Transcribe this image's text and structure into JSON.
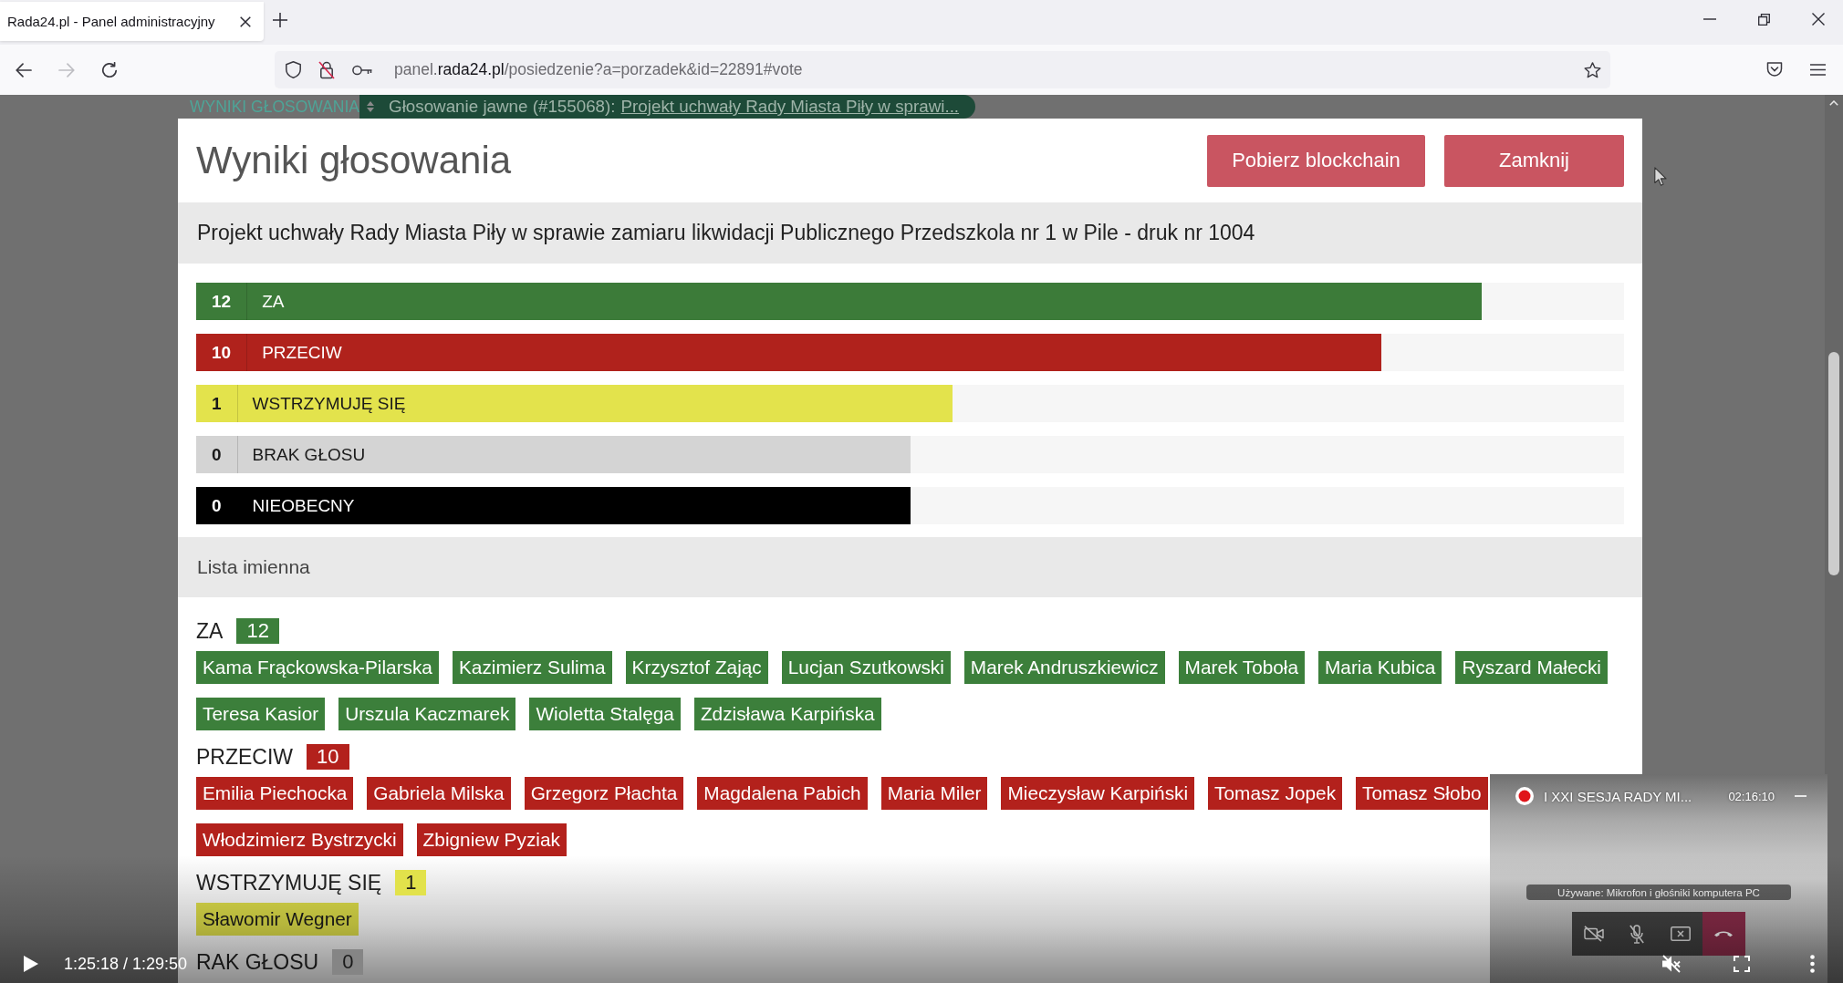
{
  "browser": {
    "tabs": [
      {
        "title": "Rada24.pl - Panel administracyjny",
        "selected": true
      }
    ],
    "nav_buttons": [
      {
        "disabled": false
      },
      {
        "disabled": true
      },
      {
        "disabled": false
      }
    ],
    "url": {
      "prefix": "panel.",
      "domain": "rada24.pl",
      "path": "/posiedzenie?a=porzadek&id=22891#vote"
    }
  },
  "page": {
    "section": "WYNIKI GŁOSOWANIA",
    "vote_label": "Głosowanie jawne (#155068):",
    "vote_link": "Projekt uchwały Rady Miasta Piły w sprawi..."
  },
  "modal": {
    "title": "Wyniki głosowania",
    "buttons": [
      "Pobierz blockchain",
      "Zamknij"
    ],
    "subject": "Projekt uchwały Rady Miasta Piły w sprawie zamiaru likwidacji Publicznego Przedszkola nr 1 w Pile - druk nr 1004",
    "results": [
      {
        "count": "12",
        "label": "ZA",
        "color": "#3c7b39",
        "level": 0.9
      },
      {
        "count": "10",
        "label": "PRZECIW",
        "color": "#b0221c",
        "level": 0.83
      },
      {
        "count": "1",
        "label": "WSTRZYMUJĘ SIĘ",
        "color": "#e3e34c",
        "level": 0.53
      },
      {
        "count": "0",
        "label": "BRAK GŁOSU",
        "color": "#d4d4d4",
        "level": 0.5
      },
      {
        "count": "0",
        "label": "NIEOBECNY",
        "color": "#000000",
        "level": 0.5
      }
    ],
    "list_title": "Lista imienna",
    "groups": [
      {
        "label": "ZA",
        "count": "12",
        "color": "#3c7f3b",
        "members": [
          "Kama Frąckowska-Pilarska",
          "Kazimierz Sulima",
          "Krzysztof Zając",
          "Lucjan Szutkowski",
          "Marek Andruszkiewicz",
          "Marek Toboła",
          "Maria Kubica",
          "Ryszard Małecki",
          "Teresa Kasior",
          "Urszula Kaczmarek",
          "Wioletta Stalęga",
          "Zdzisława Karpińska"
        ]
      },
      {
        "label": "PRZECIW",
        "count": "10",
        "color": "#b3211c",
        "members": [
          "Emilia Piechocka",
          "Gabriela Milska",
          "Grzegorz Płachta",
          "Magdalena Pabich",
          "Maria Miler",
          "Mieczysław Karpiński",
          "Tomasz Jopek",
          "Tomasz Słobo",
          "Włodzimierz Bystrzycki",
          "Zbigniew Pyziak"
        ]
      },
      {
        "label": "WSTRZYMUJĘ SIĘ",
        "count": "1",
        "color": "#e2e24b",
        "members": [
          "Sławomir Wegner"
        ]
      },
      {
        "label": "RAK GŁOSU",
        "count": "0",
        "color": "#858585"
      }
    ]
  },
  "call_window": {
    "title": "I XXI SESJA RADY MI...",
    "time": "02:16:10",
    "caption": "Używane: Mikrofon i głośniki komputera PC",
    "camera_off": true,
    "mic_off": true
  },
  "player": {
    "paused": true,
    "muted": true,
    "time": "1:25:18 / 1:29:50"
  }
}
